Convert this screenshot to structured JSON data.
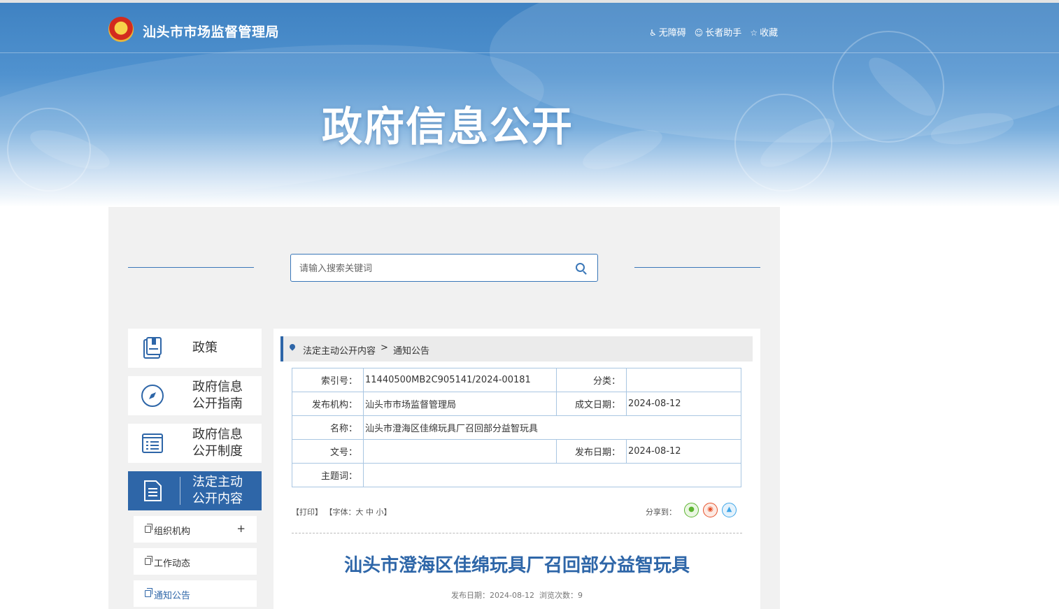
{
  "header": {
    "site_name": "汕头市市场监督管理局",
    "links": [
      {
        "icon": "accessibility-icon",
        "label": "无障碍"
      },
      {
        "icon": "elder-helper-icon",
        "label": "长者助手"
      },
      {
        "icon": "star-icon",
        "label": "收藏"
      }
    ],
    "banner_title": "政府信息公开"
  },
  "search": {
    "placeholder": "请输入搜索关键词"
  },
  "sidebar": {
    "items": [
      {
        "icon": "book-icon",
        "line1": "政策",
        "line2": ""
      },
      {
        "icon": "compass-icon",
        "line1": "政府信息",
        "line2": "公开指南"
      },
      {
        "icon": "list-icon",
        "line1": "政府信息",
        "line2": "公开制度"
      },
      {
        "icon": "document-icon",
        "line1": "法定主动",
        "line2": "公开内容"
      }
    ],
    "subitems": [
      {
        "label": "组织机构",
        "expand": "+"
      },
      {
        "label": "工作动态"
      },
      {
        "label": "通知公告"
      }
    ]
  },
  "breadcrumb": {
    "level1": "法定主动公开内容",
    "separator": ">",
    "level2": "通知公告"
  },
  "meta": {
    "index_no_label": "索引号：",
    "index_no": "11440500MB2C905141/2024-00181",
    "category_label": "分类：",
    "category": "",
    "publisher_label": "发布机构：",
    "publisher": "汕头市市场监督管理局",
    "created_label": "成文日期：",
    "created": "2024-08-12",
    "name_label": "名称：",
    "name": "汕头市澄海区佳绵玩具厂召回部分益智玩具",
    "doc_no_label": "文号：",
    "doc_no": "",
    "publish_label": "发布日期：",
    "publish": "2024-08-12",
    "keywords_label": "主题词：",
    "keywords": ""
  },
  "tools": {
    "print": "【打印】",
    "font_prefix": "【字体：",
    "font_large": "大",
    "font_medium": "中",
    "font_small": "小",
    "font_suffix": "】",
    "share_label": "分享到："
  },
  "article": {
    "title": "汕头市澄海区佳绵玩具厂召回部分益智玩具",
    "date_label": "发布日期：2024-08-12",
    "views_label": "浏览次数：9"
  },
  "colors": {
    "accent": "#2e66a8",
    "wechat": "#5cb531",
    "weibo": "#e6522c",
    "qq": "#3ea6e8"
  }
}
